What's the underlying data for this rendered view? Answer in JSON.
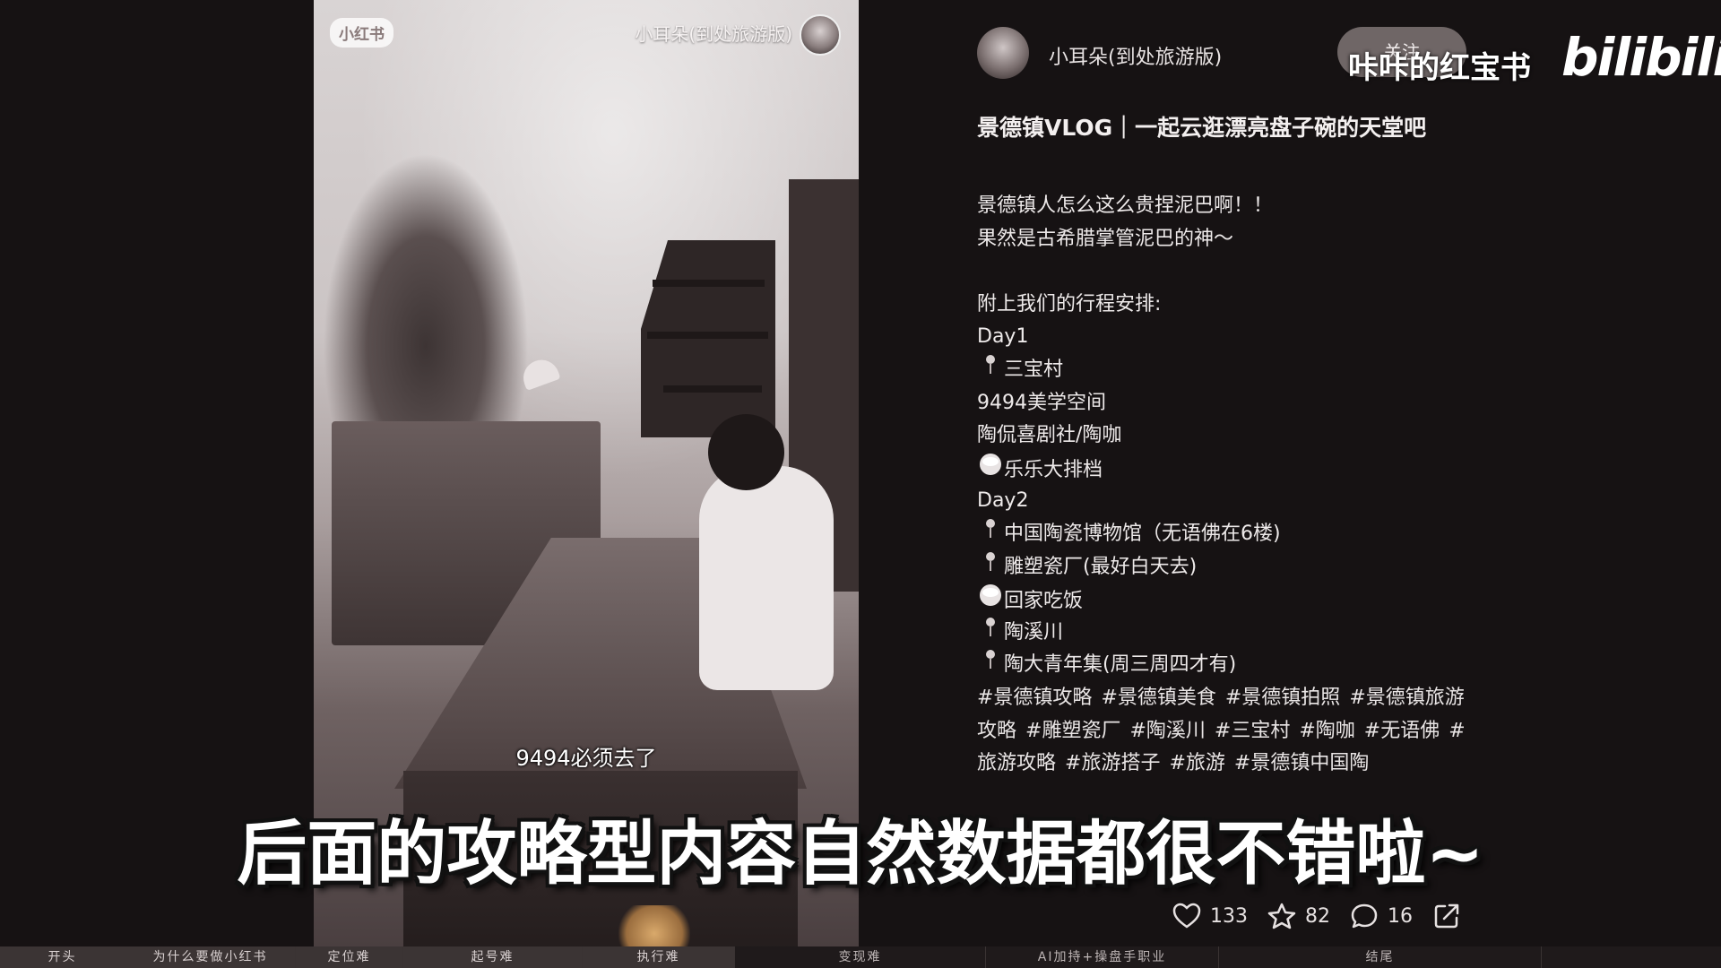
{
  "video": {
    "logo_label": "小红书",
    "author_name": "小耳朵(到处旅游版)",
    "caption": "9494必须去了"
  },
  "post": {
    "author_name": "小耳朵(到处旅游版)",
    "follow_label": "关注",
    "title": "景德镇VLOG｜一起云逛漂亮盘子碗的天堂吧",
    "lines": [
      {
        "marker": "",
        "text": "景德镇人怎么这么贵捏泥巴啊！！"
      },
      {
        "marker": "",
        "text": "果然是古希腊掌管泥巴的神～"
      },
      {
        "marker": "",
        "text": ""
      },
      {
        "marker": "",
        "text": "附上我们的行程安排:"
      },
      {
        "marker": "",
        "text": "Day1"
      },
      {
        "marker": "pin",
        "text": "三宝村"
      },
      {
        "marker": "",
        "text": "9494美学空间"
      },
      {
        "marker": "",
        "text": "陶侃喜剧社/陶咖"
      },
      {
        "marker": "bowl",
        "text": "乐乐大排档"
      },
      {
        "marker": "",
        "text": "Day2"
      },
      {
        "marker": "pin",
        "text": "中国陶瓷博物馆（无语佛在6楼)"
      },
      {
        "marker": "pin",
        "text": "雕塑瓷厂(最好白天去)"
      },
      {
        "marker": "bowl",
        "text": "回家吃饭"
      },
      {
        "marker": "pin",
        "text": "陶溪川"
      },
      {
        "marker": "pin",
        "text": "陶大青年集(周三周四才有)"
      }
    ],
    "tags": [
      "#景德镇攻略",
      "#景德镇美食",
      "#景德镇拍照",
      "#景德镇旅游攻略",
      "#雕塑瓷厂",
      "#陶溪川",
      "#三宝村",
      "#陶咖",
      "#无语佛",
      "#旅游攻略",
      "#旅游搭子",
      "#旅游",
      "#景德镇中国陶"
    ],
    "stats": {
      "likes": "133",
      "favorites": "82",
      "comments": "16"
    }
  },
  "overlay": {
    "watermark": "咔咔的红宝书",
    "platform_logo": "bilibili",
    "subtitle": "后面的攻略型内容自然数据都很不错啦~"
  },
  "timeline": {
    "chapters": [
      {
        "label": "开头",
        "done": true
      },
      {
        "label": "为什么要做小红书",
        "done": true
      },
      {
        "label": "定位难",
        "done": true
      },
      {
        "label": "起号难",
        "done": true
      },
      {
        "label": "执行难",
        "done": true
      },
      {
        "label": "变现难",
        "done": false
      },
      {
        "label": "AI加持+操盘手职业",
        "done": false
      },
      {
        "label": "结尾",
        "done": false
      }
    ]
  },
  "icons": {
    "pin": "map-pin-icon",
    "bowl": "rice-bowl-icon",
    "like": "heart-icon",
    "favorite": "star-icon",
    "comment": "comment-icon",
    "share": "share-icon"
  }
}
